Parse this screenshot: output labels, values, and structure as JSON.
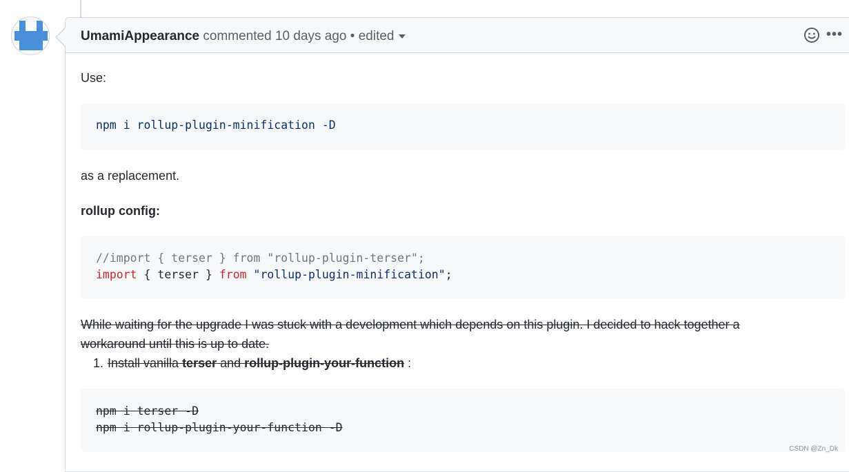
{
  "comment": {
    "author": "UmamiAppearance",
    "action": "commented",
    "time": "10 days ago",
    "separator": "•",
    "edited": "edited"
  },
  "icons": {
    "avatar": "avatar-identicon",
    "emoji": "smiley-icon",
    "more": "kebab-horizontal-icon",
    "accent": "#4a90d9"
  },
  "body": {
    "use_label": "Use:",
    "install_cmd": "npm i rollup-plugin-minification -D",
    "replacement_text": "as a replacement.",
    "config_heading": "rollup config:",
    "code_comment": "//import { terser } from \"rollup-plugin-terser\";",
    "code_import_kw": "import",
    "code_brace_open": " { ",
    "code_terser": "terser",
    "code_brace_close": " } ",
    "code_from_kw": "from",
    "code_space": " ",
    "code_module": "\"rollup-plugin-minification\"",
    "code_semicolon": ";",
    "strike_para_line1": "While waiting for the upgrade I was stuck with a development which depends on this plugin. I decided to hack together a",
    "strike_para_line2": "workaround until this is up to date.",
    "list_number": "1.",
    "list_text_a": "Install vanilla ",
    "list_text_terser": "terser",
    "list_text_and": " and ",
    "list_text_plugin": "rollup-plugin-your-function",
    "list_text_colon": " :",
    "strike_cmd1": "npm i terser -D",
    "strike_cmd2": "npm i rollup-plugin-your-function -D"
  },
  "watermark": "CSDN @Zn_Dk"
}
